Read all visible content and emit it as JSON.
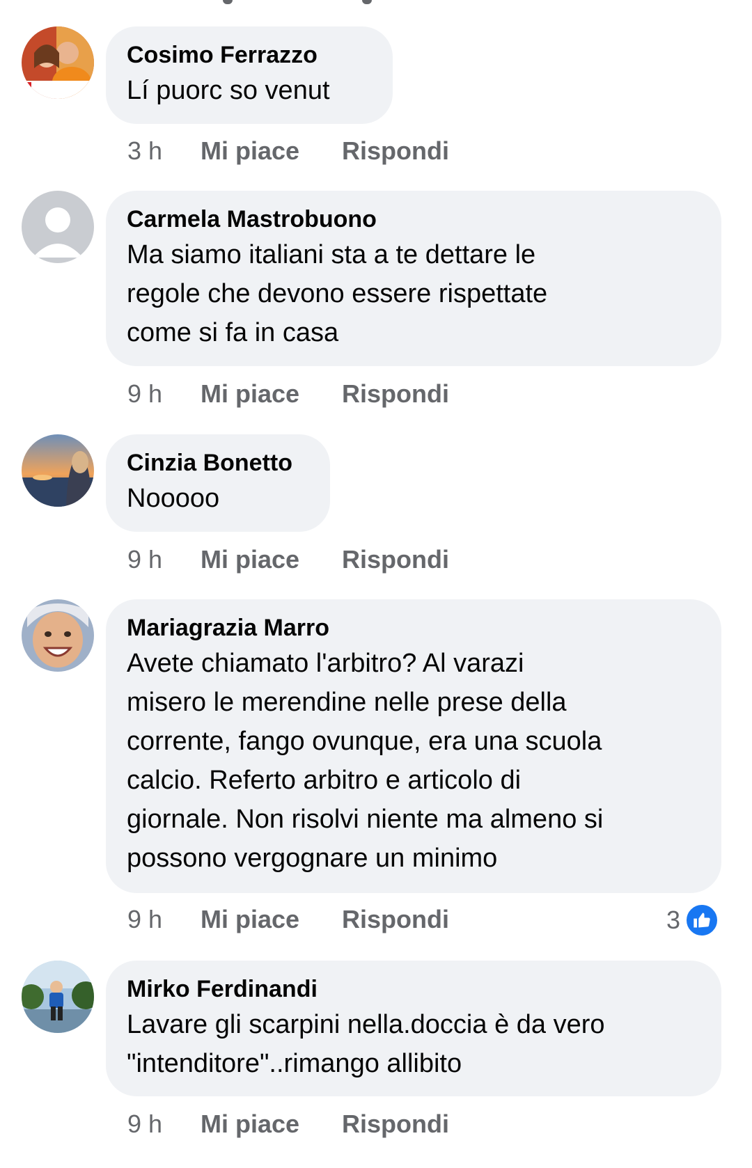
{
  "comments": [
    {
      "author": "Cosimo Ferrazzo",
      "text": "Lí puorc so venut",
      "time": "3 h",
      "like_label": "Mi piace",
      "reply_label": "Rispondi",
      "avatar_icon": "avatar-couple-photo-icon"
    },
    {
      "author": "Carmela Mastrobuono",
      "text": "Ma siamo italiani sta a te dettare le\nregole che devono essere rispettate\ncome si fa in casa",
      "time": "9 h",
      "like_label": "Mi piace",
      "reply_label": "Rispondi",
      "avatar_icon": "default-avatar-icon"
    },
    {
      "author": "Cinzia Bonetto",
      "text": "Nooooo",
      "time": "9 h",
      "like_label": "Mi piace",
      "reply_label": "Rispondi",
      "avatar_icon": "avatar-sunset-photo-icon"
    },
    {
      "author": "Mariagrazia Marro",
      "text": "Avete chiamato l'arbitro? Al varazi\nmisero le merendine nelle prese della\ncorrente, fango ovunque, era una scuola\ncalcio. Referto arbitro e articolo di\ngiornale. Non risolvi niente ma almeno si\npossono vergognare un minimo",
      "time": "9 h",
      "like_label": "Mi piace",
      "reply_label": "Rispondi",
      "reaction_count": "3",
      "reaction_icon": "thumbs-up-icon",
      "avatar_icon": "avatar-smiling-woman-icon"
    },
    {
      "author": "Mirko Ferdinandi",
      "text": "Lavare gli scarpini nella.doccia è da vero\n\"intenditore\"..rimango allibito",
      "time": "9 h",
      "like_label": "Mi piace",
      "reply_label": "Rispondi",
      "avatar_icon": "avatar-child-photo-icon"
    }
  ],
  "colors": {
    "bubble": "#f0f2f5",
    "meta": "#65676b",
    "text": "#050505",
    "like_blue": "#1877f2"
  }
}
